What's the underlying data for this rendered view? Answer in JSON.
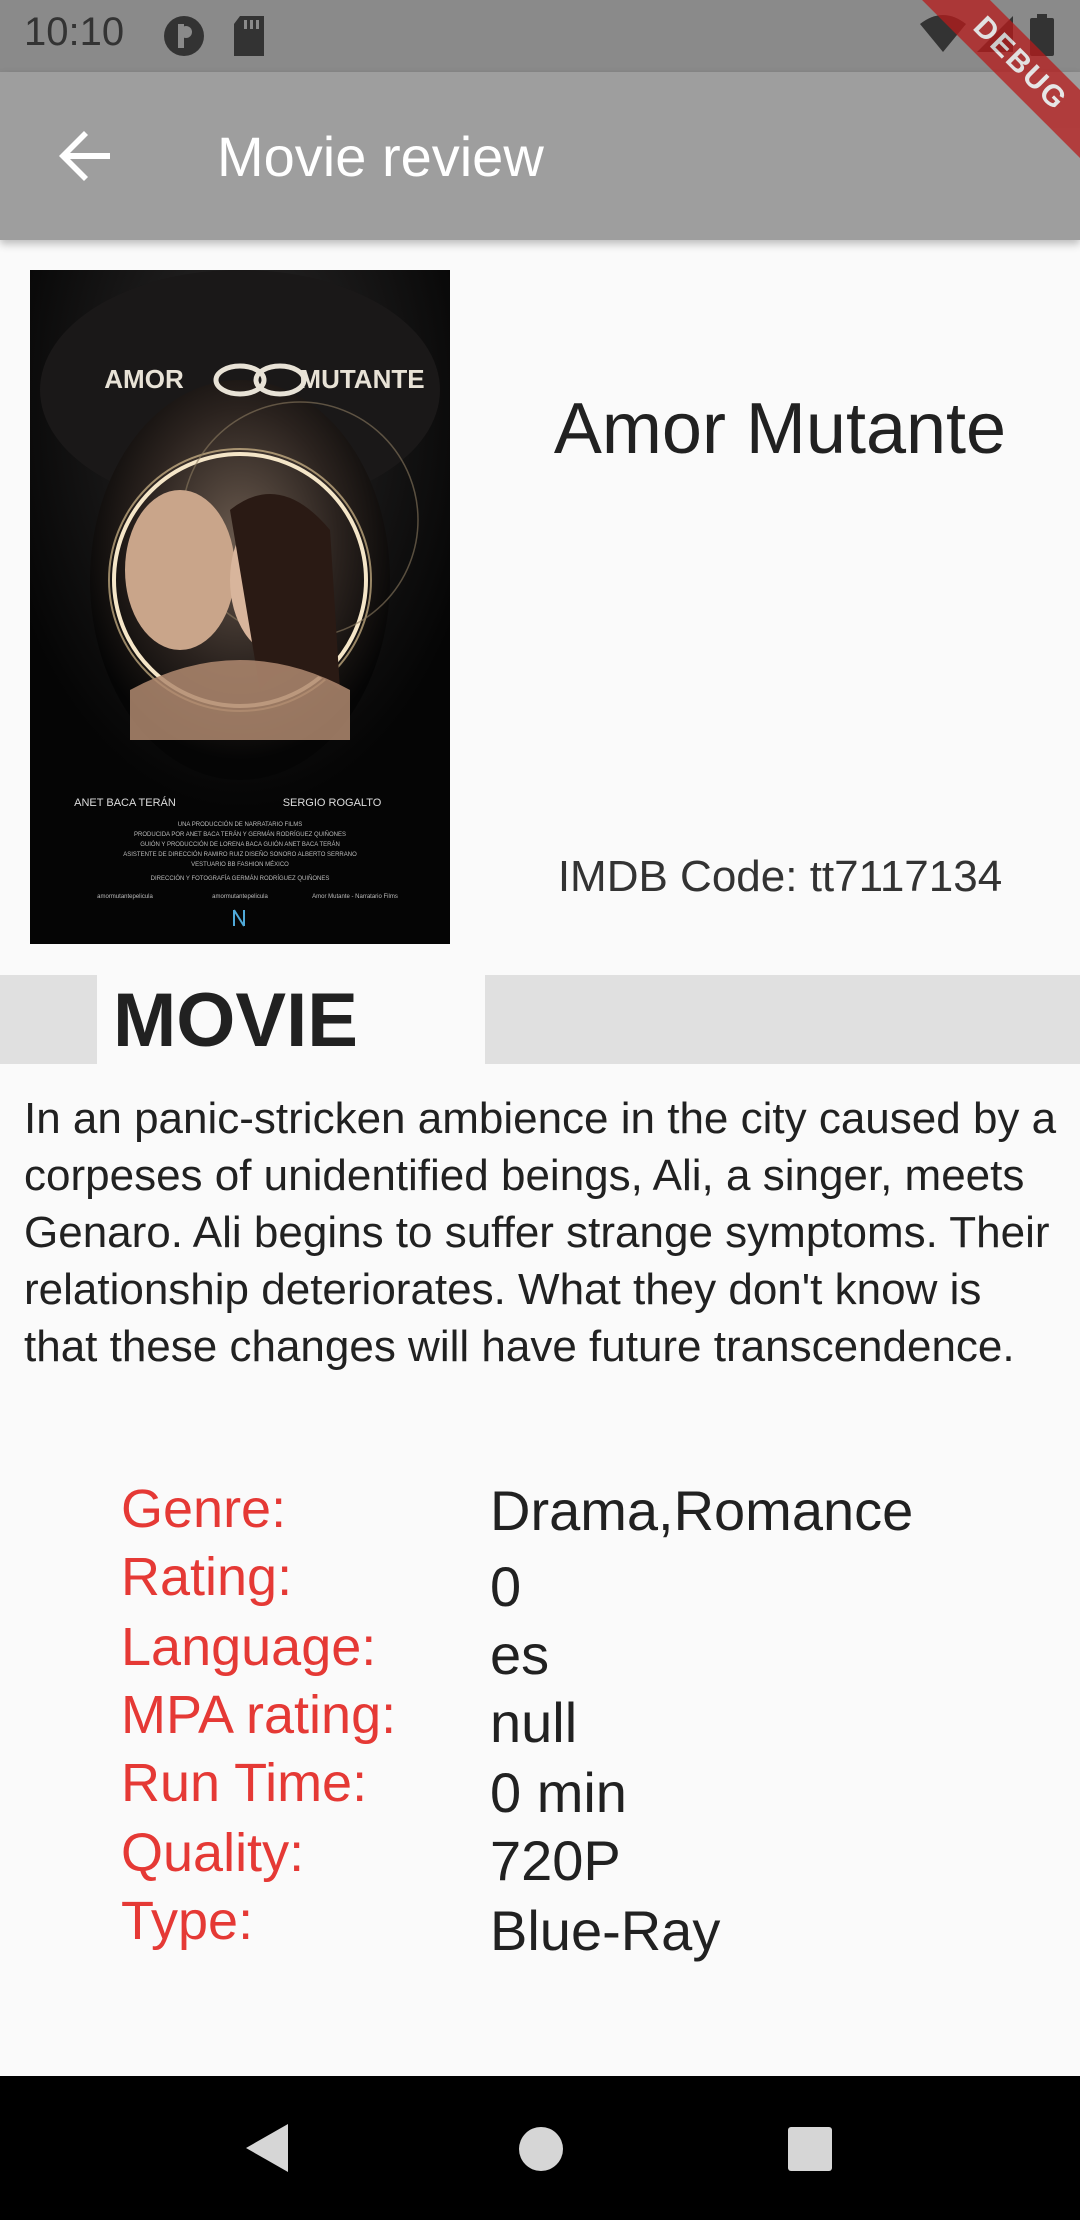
{
  "status_bar": {
    "time": "10:10"
  },
  "app_bar": {
    "title": "Movie review",
    "back_icon": "arrow-back-icon"
  },
  "debug_ribbon": "DEBUG",
  "movie": {
    "title": "Amor Mutante",
    "imdb_label": "IMDB Code: tt7117134",
    "section_label": "MOVIE",
    "description": "In an panic-stricken ambience in the city caused by a corpeses of unidentified beings, Ali, a singer, meets Genaro. Ali begins to suffer strange symptoms. Their relationship deteriorates. What they don't know is that these changes will have future transcendence.",
    "poster": {
      "title_left": "AMOR",
      "title_right": "MUTANTE",
      "actor_left": "ANET BACA TERÁN",
      "actor_right": "SERGIO ROGALTO",
      "credits": [
        "UNA PRODUCCIÓN DE NARRATARIO FILMS",
        "PRODUCIDA POR ANET BACA TERÁN Y GERMÁN RODRÍGUEZ QUIÑONES",
        "GUIÓN Y PRODUCCIÓN DE LORENA BACA GUIÓN ANET BACA TERÁN",
        "ASISTENTE DE DIRECCIÓN RAMIRO RUIZ DISEÑO SONORO ALBERTO SERRANO",
        "VESTUARIO BB FASHION MÉXICO",
        "DIRECCIÓN Y FOTOGRAFÍA GERMÁN RODRÍGUEZ QUIÑONES"
      ],
      "social": [
        "amormutantepelicula",
        "amormutantepelicula",
        "Amor Mutante - Narratario Films"
      ]
    }
  },
  "details": [
    {
      "label": "Genre:",
      "value": "Drama,Romance"
    },
    {
      "label": "Rating:",
      "value": "0"
    },
    {
      "label": "Language:",
      "value": "es"
    },
    {
      "label": "MPA rating:",
      "value": "null"
    },
    {
      "label": "Run Time:",
      "value": "0 min"
    },
    {
      "label": "Quality:",
      "value": "720P"
    },
    {
      "label": "Type:",
      "value": "Blue-Ray"
    }
  ],
  "colors": {
    "app_bar": "#9e9e9e",
    "status_bar": "#8a8a8a",
    "label_red": "#e53935",
    "band_gray": "#e0e0e0",
    "debug_ribbon": "#b71c1c"
  },
  "nav": {
    "back": "nav-back-icon",
    "home": "nav-home-icon",
    "recents": "nav-recents-icon"
  }
}
